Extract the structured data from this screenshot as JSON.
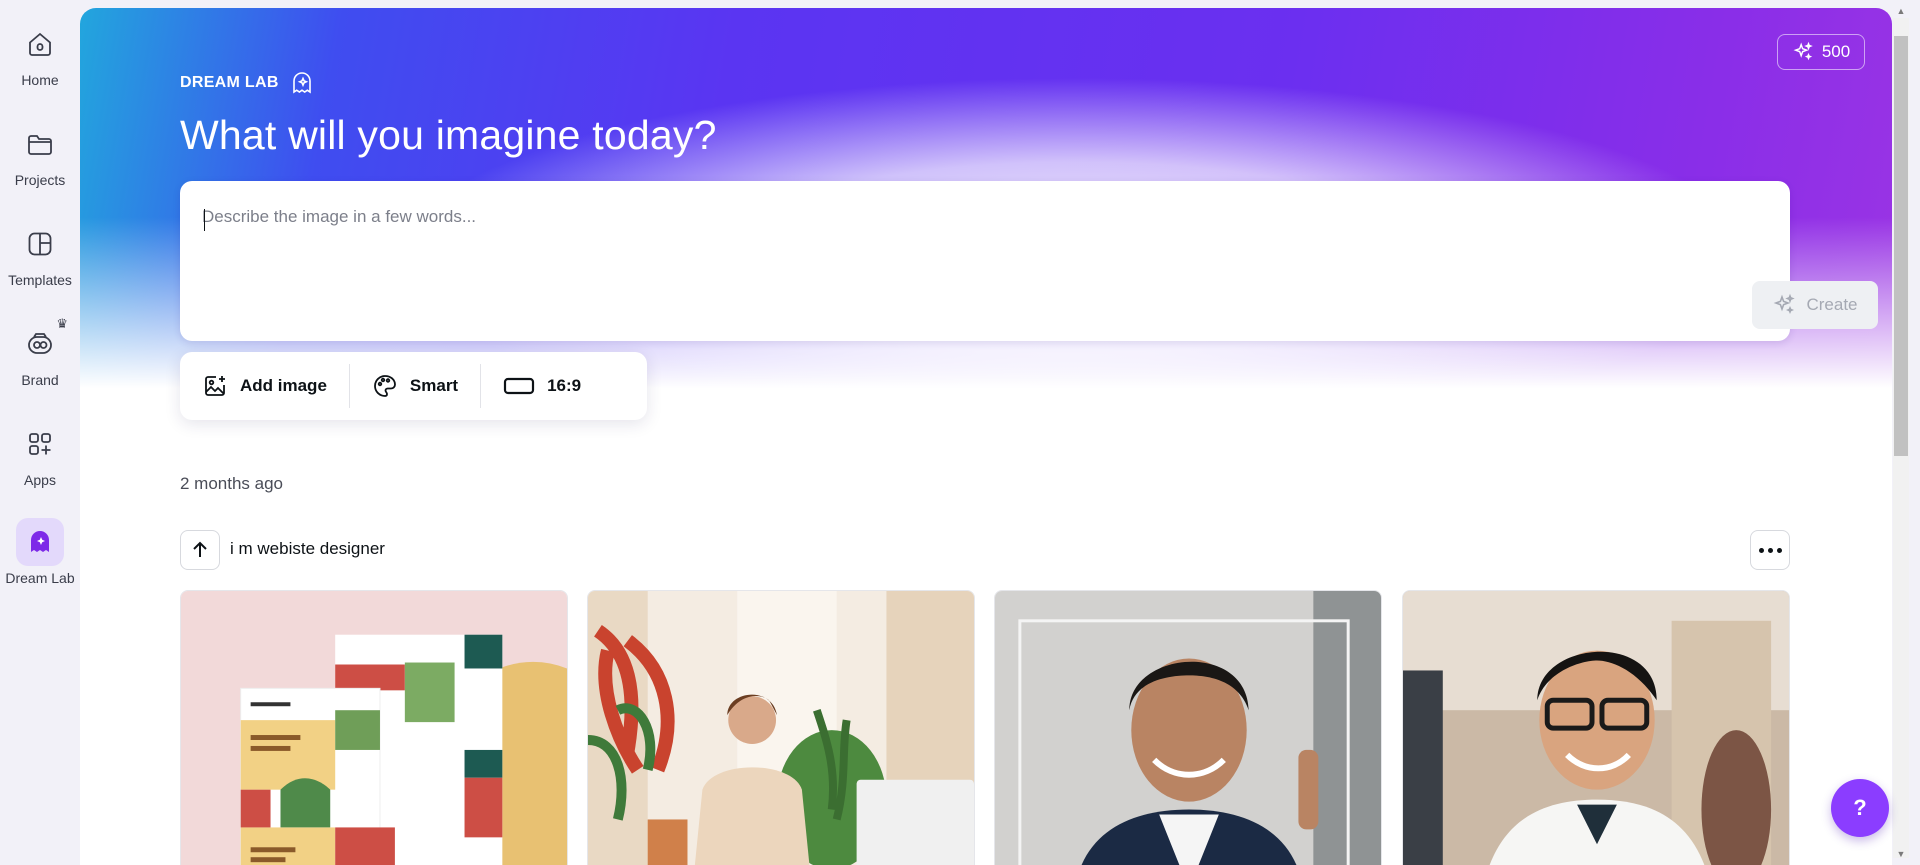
{
  "rail": {
    "items": [
      {
        "label": "Home",
        "icon": "home-icon"
      },
      {
        "label": "Projects",
        "icon": "folder-icon"
      },
      {
        "label": "Templates",
        "icon": "templates-icon"
      },
      {
        "label": "Brand",
        "icon": "brand-icon",
        "badge": "crown-icon"
      },
      {
        "label": "Apps",
        "icon": "apps-icon"
      },
      {
        "label": "Dream Lab",
        "icon": "dream-lab-icon",
        "active": true
      }
    ]
  },
  "header": {
    "credits": "500",
    "brand_label": "DREAM LAB",
    "headline": "What will you imagine today?"
  },
  "prompt": {
    "placeholder": "Describe the image in a few words...",
    "value": "",
    "create_label": "Create"
  },
  "options": {
    "add_image": "Add image",
    "style": "Smart",
    "aspect_ratio": "16:9"
  },
  "history": {
    "timestamp": "2 months ago",
    "group_title": "i m webiste designer",
    "thumbnails": [
      {
        "subject": "website-mockup-image"
      },
      {
        "subject": "woman-at-desk-image"
      },
      {
        "subject": "man-in-suit-portrait-image"
      },
      {
        "subject": "man-with-glasses-office-image"
      }
    ]
  },
  "help": {
    "label": "?"
  },
  "colors": {
    "accent": "#8b3dff",
    "hero_start": "#22a6dd",
    "hero_mid": "#5a35f2",
    "hero_end": "#9a34e4"
  }
}
